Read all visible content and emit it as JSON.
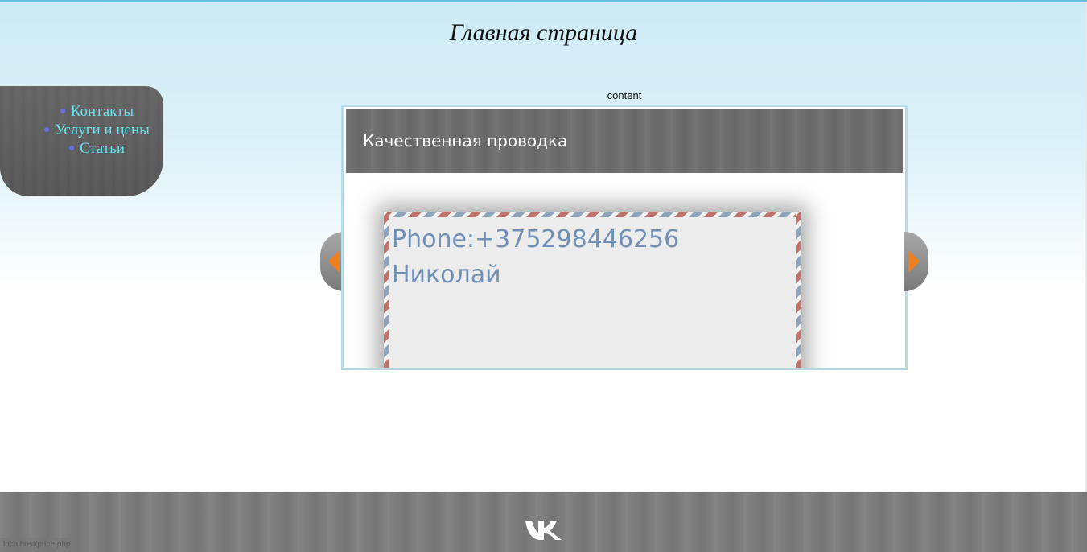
{
  "page": {
    "title": "Главная страница"
  },
  "nav": {
    "items": [
      {
        "label": "Контакты"
      },
      {
        "label": "Услуги и цены"
      },
      {
        "label": "Статьи"
      }
    ]
  },
  "content": {
    "label": "content",
    "slide": {
      "title": "Качественная проводка",
      "card": {
        "phone": "Phone:+375298446256",
        "name": "Николай"
      }
    },
    "prev_icon": "arrow-left-icon",
    "next_icon": "arrow-right-icon"
  },
  "footer": {
    "social_icon": "vk-icon"
  },
  "status_bar": {
    "url": "localhost/price.php"
  },
  "colors": {
    "accent_line": "#5cc3dd",
    "nav_link": "#64e3ef",
    "card_text": "#6f90b6",
    "arrow_fill": "#f07f1e"
  }
}
